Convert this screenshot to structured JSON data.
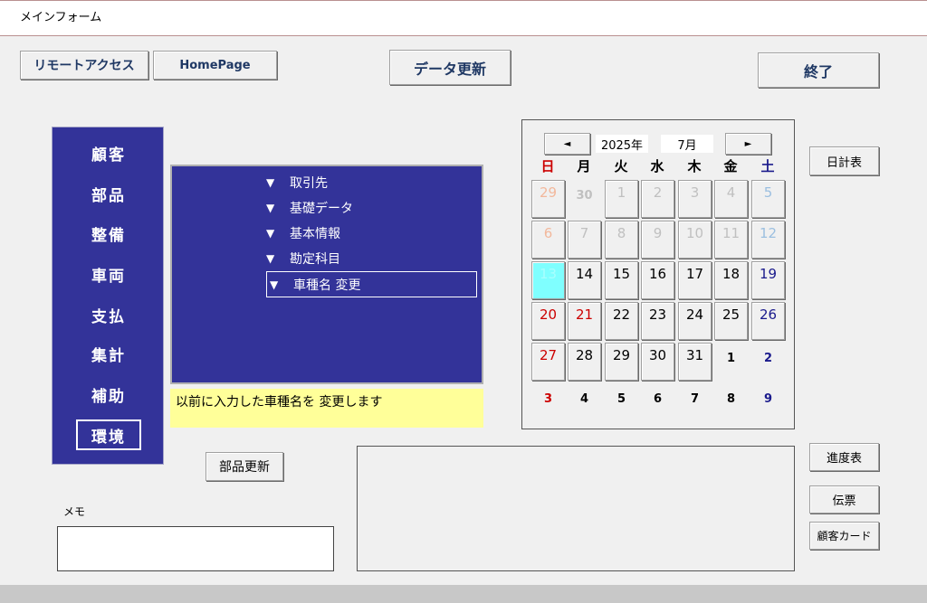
{
  "window": {
    "title": "メインフォーム"
  },
  "toolbar": {
    "remote_access": "リモートアクセス",
    "homepage": "HomePage",
    "data_update": "データ更新",
    "exit": "終了"
  },
  "nav": {
    "items": [
      {
        "label": "顧客"
      },
      {
        "label": "部品"
      },
      {
        "label": "整備"
      },
      {
        "label": "車両"
      },
      {
        "label": "支払"
      },
      {
        "label": "集計"
      },
      {
        "label": "補助"
      },
      {
        "label": "環境",
        "selected": true
      }
    ]
  },
  "submenu": {
    "marker": "▼",
    "items": [
      {
        "label": "取引先"
      },
      {
        "label": "基礎データ"
      },
      {
        "label": "基本情報"
      },
      {
        "label": "勘定科目"
      },
      {
        "label": "車種名 変更",
        "selected": true
      }
    ],
    "description": "以前に入力した車種名を 変更します"
  },
  "buttons": {
    "parts_update": "部品更新",
    "daily_table": "日計表",
    "progress_table": "進度表",
    "slip": "伝票",
    "customer_card": "顧客カード"
  },
  "memo": {
    "label": "メモ",
    "value": ""
  },
  "calendar": {
    "prev": "◄",
    "next": "►",
    "year": "2025年",
    "month": "7月",
    "weekdays": [
      "日",
      "月",
      "火",
      "水",
      "木",
      "金",
      "土"
    ],
    "weekday_colors": [
      "#cc0000",
      "#000000",
      "#000000",
      "#000000",
      "#000000",
      "#000000",
      "#1a1a8c"
    ],
    "weeks": [
      [
        {
          "d": "29",
          "c": "pinkgray",
          "s": "bt"
        },
        {
          "d": "30",
          "c": "gray",
          "s": "plain"
        },
        {
          "d": "1",
          "c": "gray",
          "s": "bt"
        },
        {
          "d": "2",
          "c": "gray",
          "s": "bt"
        },
        {
          "d": "3",
          "c": "gray",
          "s": "bt"
        },
        {
          "d": "4",
          "c": "gray",
          "s": "bt"
        },
        {
          "d": "5",
          "c": "lightblue",
          "s": "bt"
        }
      ],
      [
        {
          "d": "6",
          "c": "pinkgray",
          "s": "bt"
        },
        {
          "d": "7",
          "c": "gray",
          "s": "bt"
        },
        {
          "d": "8",
          "c": "gray",
          "s": "bt"
        },
        {
          "d": "9",
          "c": "gray",
          "s": "bt"
        },
        {
          "d": "10",
          "c": "gray",
          "s": "bt"
        },
        {
          "d": "11",
          "c": "gray",
          "s": "bt"
        },
        {
          "d": "12",
          "c": "lightblue",
          "s": "bt"
        }
      ],
      [
        {
          "d": "13",
          "c": "cyan",
          "s": "bt",
          "today": true
        },
        {
          "d": "14",
          "c": "black",
          "s": "bt"
        },
        {
          "d": "15",
          "c": "black",
          "s": "bt"
        },
        {
          "d": "16",
          "c": "black",
          "s": "bt"
        },
        {
          "d": "17",
          "c": "black",
          "s": "bt"
        },
        {
          "d": "18",
          "c": "black",
          "s": "bt"
        },
        {
          "d": "19",
          "c": "blue",
          "s": "bt"
        }
      ],
      [
        {
          "d": "20",
          "c": "red",
          "s": "bt"
        },
        {
          "d": "21",
          "c": "red",
          "s": "bt"
        },
        {
          "d": "22",
          "c": "black",
          "s": "bt"
        },
        {
          "d": "23",
          "c": "black",
          "s": "bt"
        },
        {
          "d": "24",
          "c": "black",
          "s": "bt"
        },
        {
          "d": "25",
          "c": "black",
          "s": "bt"
        },
        {
          "d": "26",
          "c": "blue",
          "s": "bt"
        }
      ],
      [
        {
          "d": "27",
          "c": "red",
          "s": "bt"
        },
        {
          "d": "28",
          "c": "black",
          "s": "bt"
        },
        {
          "d": "29",
          "c": "black",
          "s": "bt"
        },
        {
          "d": "30",
          "c": "black",
          "s": "bt"
        },
        {
          "d": "31",
          "c": "black",
          "s": "bt"
        },
        {
          "d": "1",
          "c": "black",
          "s": "plain"
        },
        {
          "d": "2",
          "c": "blue",
          "s": "plain"
        }
      ],
      [
        {
          "d": "3",
          "c": "red",
          "s": "plain"
        },
        {
          "d": "4",
          "c": "black",
          "s": "plain"
        },
        {
          "d": "5",
          "c": "black",
          "s": "plain"
        },
        {
          "d": "6",
          "c": "black",
          "s": "plain"
        },
        {
          "d": "7",
          "c": "black",
          "s": "plain"
        },
        {
          "d": "8",
          "c": "black",
          "s": "plain"
        },
        {
          "d": "9",
          "c": "blue",
          "s": "plain"
        }
      ]
    ]
  }
}
